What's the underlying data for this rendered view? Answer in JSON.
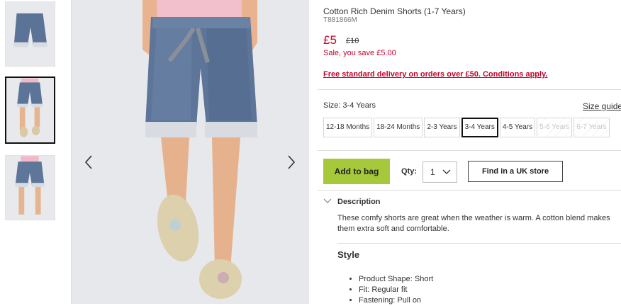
{
  "product": {
    "title": "Cotton Rich Denim Shorts (1-7 Years)",
    "sku": "T881866M",
    "price": "£5",
    "old_price": "£10",
    "saving": "Sale, you save £5.00",
    "delivery": "Free standard delivery on orders over £50. Conditions apply."
  },
  "size": {
    "label": "Size: 3-4 Years",
    "guide": "Size guide",
    "options": [
      "12-18 Months",
      "18-24 Months",
      "2-3 Years",
      "3-4 Years",
      "4-5 Years",
      "5-6 Years",
      "6-7 Years"
    ],
    "selected": "3-4 Years",
    "unavailable": [
      "5-6 Years",
      "6-7 Years"
    ]
  },
  "purchase": {
    "add_to_bag": "Add to bag",
    "qty_label": "Qty:",
    "qty_value": "1",
    "find_in_store": "Find in a UK store"
  },
  "description": {
    "heading": "Description",
    "text": "These comfy shorts are great when the weather is warm. A cotton blend makes them extra soft and comfortable.",
    "style_heading": "Style",
    "bullets": [
      "Product Shape: Short",
      "Fit: Regular fit",
      "Fastening: Pull on"
    ]
  },
  "gallery": {
    "selected_thumbnail": 2,
    "icons": [
      "chevron-left-icon",
      "chevron-right-icon"
    ]
  },
  "colors": {
    "accent_red": "#c7002b",
    "add_button": "#a6c83b"
  }
}
